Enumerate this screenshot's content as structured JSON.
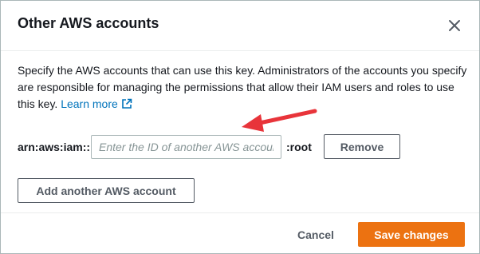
{
  "dialog": {
    "title": "Other AWS accounts",
    "close_icon": "close-icon"
  },
  "description": {
    "text": "Specify the AWS accounts that can use this key. Administrators of the accounts you specify are responsible for managing the permissions that allow their IAM users and roles to use this key.",
    "link_label": "Learn more",
    "link_icon": "external-link-icon"
  },
  "account_row": {
    "prefix": "arn:aws:iam::",
    "input_value": "",
    "input_placeholder": "Enter the ID of another AWS account",
    "suffix": ":root",
    "remove_label": "Remove"
  },
  "add_account_label": "Add another AWS account",
  "footer": {
    "cancel_label": "Cancel",
    "save_label": "Save changes"
  },
  "colors": {
    "primary_button": "#ec7211",
    "link": "#0073bb",
    "annotation_arrow": "#e8343a"
  }
}
